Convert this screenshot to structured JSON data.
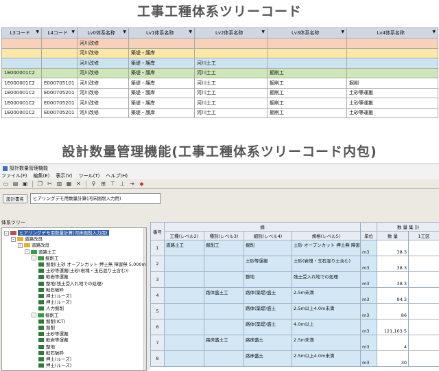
{
  "heading1": "工事工種体系ツリーコード",
  "heading2": "設計数量管理機能(工事工種体系ツリーコード内包)",
  "grid1": {
    "headers": [
      "L3コード",
      "L4コード",
      "Lv0体系名称",
      "Lv1体系名称",
      "Lv2体系名称",
      "Lv3体系名称",
      "Lv4体系名称"
    ],
    "rows": [
      [
        "",
        "",
        "河川改修",
        "",
        "",
        "",
        ""
      ],
      [
        "",
        "",
        "河川改修",
        "築堤・護岸",
        "",
        "",
        ""
      ],
      [
        "",
        "",
        "河川改修",
        "築堤・護岸",
        "河川土工",
        "",
        ""
      ],
      [
        "1E000001C2",
        "",
        "河川改修",
        "築堤・護岸",
        "河川土工",
        "掘削工",
        ""
      ],
      [
        "1E000001C2",
        "E000705101",
        "河川改修",
        "築堤・護岸",
        "河川土工",
        "掘削工",
        "掘削"
      ],
      [
        "1E000001C2",
        "E000705201",
        "河川改修",
        "築堤・護岸",
        "河川土工",
        "掘削工",
        "土砂等運搬"
      ],
      [
        "1E000001C2",
        "E000705201",
        "河川改修",
        "築堤・護岸",
        "河川土工",
        "掘削工",
        "土砂等運搬"
      ],
      [
        "1E000001C2",
        "E000705201",
        "河川改修",
        "築堤・護岸",
        "河川土工",
        "掘削工",
        "土砂等運搬"
      ]
    ]
  },
  "app": {
    "title": "設計数量管理機能",
    "menu": [
      "ファイル(F)",
      "編集(E)",
      "表示(V)",
      "ツール(T)",
      "ヘルプ(H)"
    ],
    "region_button": "設計書名",
    "region_value": "ヒアリングデモ用数量計算(河床掘削入力用)",
    "tree_label": "体系ツリー",
    "tree": [
      {
        "depth": 0,
        "toggle": "-",
        "kind": "folder",
        "text": "ヒアリングデモ用数量計算(河床掘削入力用)",
        "selected": true
      },
      {
        "depth": 1,
        "toggle": "-",
        "kind": "folder",
        "text": "道路改良",
        "selected": false
      },
      {
        "depth": 2,
        "toggle": "-",
        "kind": "folder",
        "text": "道路改良",
        "selected": false
      },
      {
        "depth": 3,
        "toggle": "-",
        "kind": "folder",
        "text": "道路土工",
        "selected": false
      },
      {
        "depth": 4,
        "toggle": "-",
        "kind": "folder",
        "text": "掘削工",
        "selected": false
      },
      {
        "depth": 5,
        "toggle": "",
        "kind": "leaf",
        "text": "掘削(土砂 オープンカット 押土無 障害無 5,000m3)",
        "selected": false
      },
      {
        "depth": 5,
        "toggle": "",
        "kind": "leaf",
        "text": "土砂等運搬(土砂(岩塊・玉石混り土含む))",
        "selected": false
      },
      {
        "depth": 5,
        "toggle": "",
        "kind": "leaf",
        "text": "軟岩等運搬",
        "selected": false
      },
      {
        "depth": 5,
        "toggle": "",
        "kind": "leaf",
        "text": "整地(残土受入れ地での処理)",
        "selected": false
      },
      {
        "depth": 5,
        "toggle": "",
        "kind": "leaf",
        "text": "転石破砕",
        "selected": false
      },
      {
        "depth": 5,
        "toggle": "",
        "kind": "leaf",
        "text": "押土(ルーズ)",
        "selected": false
      },
      {
        "depth": 5,
        "toggle": "",
        "kind": "leaf",
        "text": "押土(ルーズ)",
        "selected": false
      },
      {
        "depth": 5,
        "toggle": "",
        "kind": "leaf",
        "text": "人力掘削",
        "selected": false
      },
      {
        "depth": 4,
        "toggle": "-",
        "kind": "folder",
        "text": "掘削工",
        "selected": false
      },
      {
        "depth": 5,
        "toggle": "",
        "kind": "leaf",
        "text": "掘削(ICT)",
        "selected": false
      },
      {
        "depth": 5,
        "toggle": "",
        "kind": "leaf",
        "text": "掘削",
        "selected": false
      },
      {
        "depth": 5,
        "toggle": "",
        "kind": "leaf",
        "text": "土砂等運搬",
        "selected": false
      },
      {
        "depth": 5,
        "toggle": "",
        "kind": "leaf",
        "text": "軟岩等運搬",
        "selected": false
      },
      {
        "depth": 5,
        "toggle": "",
        "kind": "leaf",
        "text": "整地",
        "selected": false
      },
      {
        "depth": 5,
        "toggle": "",
        "kind": "leaf",
        "text": "転石破砕",
        "selected": false
      },
      {
        "depth": 5,
        "toggle": "",
        "kind": "leaf",
        "text": "押土(ルーズ)",
        "selected": false
      },
      {
        "depth": 5,
        "toggle": "",
        "kind": "leaf",
        "text": "押土(ルーズ)",
        "selected": false
      }
    ],
    "grid2": {
      "header_top": "摘",
      "header_right": "数 量 集 計",
      "col_headers": [
        "番号",
        "工種(レベル2)",
        "種別(レベル3)",
        "細別(レベル4)",
        "規格(レベル5)",
        "単位",
        "数 量",
        "1工区"
      ],
      "rows": [
        {
          "no": "1",
          "c1": "道路土工",
          "c2": "掘削工",
          "c3": "掘削",
          "c4": "土砂 オープンカット 押土無 障害無 5,000m3以上",
          "unit": "m3",
          "qty": "38.3"
        },
        {
          "no": "2",
          "c1": "",
          "c2": "",
          "c3": "土砂等運搬",
          "c4": "土砂(岩塊・玉石混り土含む)",
          "unit": "m3",
          "qty": "38.3"
        },
        {
          "no": "3",
          "c1": "",
          "c2": "",
          "c3": "整地",
          "c4": "残土受入れ地での処理",
          "unit": "m3",
          "qty": "38.3"
        },
        {
          "no": "4",
          "c1": "",
          "c2": "路体盛土工",
          "c3": "路体(築堤)盛土",
          "c4": "2.5m未満",
          "unit": "m3",
          "qty": "94.3"
        },
        {
          "no": "5",
          "c1": "",
          "c2": "",
          "c3": "路体(築堤)盛土",
          "c4": "2.5m以上4.0m未満",
          "unit": "m3",
          "qty": "86"
        },
        {
          "no": "6",
          "c1": "",
          "c2": "",
          "c3": "路体(築堤)盛土",
          "c4": "4.0m以上",
          "unit": "m3",
          "qty": "121,103.5"
        },
        {
          "no": "7",
          "c1": "",
          "c2": "路床盛土工",
          "c3": "路床盛土",
          "c4": "2.5m未満",
          "unit": "m3",
          "qty": "4"
        },
        {
          "no": "8",
          "c1": "",
          "c2": "",
          "c3": "路床盛土",
          "c4": "2.5m以上4.0m未満",
          "unit": "m3",
          "qty": "30"
        }
      ]
    }
  },
  "colors": {
    "lv0": "#f6d1bb",
    "lv1": "#fbe7a6",
    "lv2": "#cce3f2",
    "lv3": "#cfe7b8",
    "selection": "#2f5fa8",
    "cell_blue": "#d3e7f4"
  }
}
